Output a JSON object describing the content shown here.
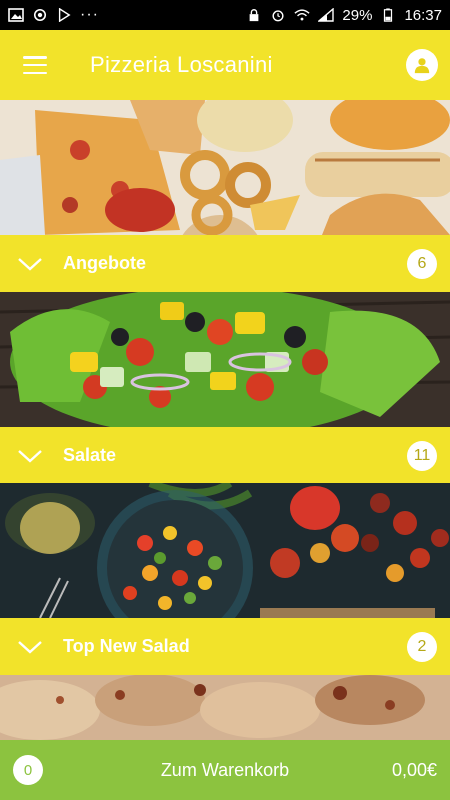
{
  "status_bar": {
    "battery": "29%",
    "time": "16:37",
    "more": "···"
  },
  "app": {
    "title": "Pizzeria Loscanini"
  },
  "categories": [
    {
      "label": "Angebote",
      "count": "6"
    },
    {
      "label": "Salate",
      "count": "11"
    },
    {
      "label": "Top New Salad",
      "count": "2"
    }
  ],
  "cart": {
    "count": "0",
    "label": "Zum Warenkorb",
    "total": "0,00€"
  },
  "colors": {
    "accent": "#f2e32a",
    "cart": "#8cc33f"
  },
  "icons": {
    "menu": "menu-icon",
    "user": "user-icon",
    "chevron": "chevron-down-icon"
  }
}
